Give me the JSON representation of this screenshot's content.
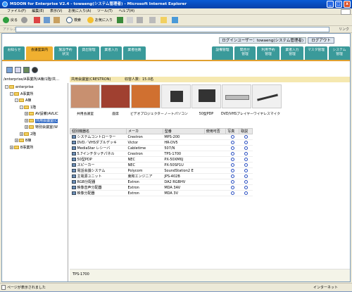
{
  "window": {
    "title": "MSOON for Enterprise V2.4 - towaeng(システム管理者) - Microsoft Internet Explorer",
    "controls": [
      "_",
      "□",
      "x"
    ]
  },
  "menu": [
    "ファイル(F)",
    "編集(E)",
    "表示(V)",
    "お気に入り(A)",
    "ツール(T)",
    "ヘルプ(H)"
  ],
  "toolbar": {
    "back": "戻る",
    "search": "検索",
    "favorites": "お気に入り"
  },
  "address": {
    "label": "アドレス(D)",
    "links": "リンク"
  },
  "login": {
    "user": "ログインユーザー：towaeng(システム管理者)",
    "logout": "ログアウト"
  },
  "tabs_left": [
    "お知らせ",
    "会議室案内",
    "施設予約\n状況",
    "貸出管理",
    "業者入力",
    "業者往路"
  ],
  "tabs_right": [
    "設備管理",
    "間合せ\n管理",
    "利用予約\n管理",
    "業者入力\n管理",
    "マスタ管理",
    "システム\n管理"
  ],
  "path": "/enterprise/A事業所/A棟/1階/共…",
  "room": {
    "name": "共用会議室(CRESTRON)",
    "capacity": "収容人数：15.0名"
  },
  "tree": [
    {
      "label": "enterprise",
      "indent": 0,
      "sign": "-"
    },
    {
      "label": "A事業所",
      "indent": 1,
      "sign": "-"
    },
    {
      "label": "A棟",
      "indent": 2,
      "sign": "-"
    },
    {
      "label": "1階",
      "indent": 3,
      "sign": "-"
    },
    {
      "label": "AV設備(AVLIC",
      "indent": 4,
      "sign": "+"
    },
    {
      "label": "共用会議室(C",
      "indent": 4,
      "sign": "+",
      "selected": true
    },
    {
      "label": "特別会議室(W",
      "indent": 4,
      "sign": "+"
    },
    {
      "label": "2階",
      "indent": 3,
      "sign": "+"
    },
    {
      "label": "B棟",
      "indent": 2,
      "sign": "+"
    },
    {
      "label": "B事業所",
      "indent": 1,
      "sign": "+"
    }
  ],
  "gallery": [
    {
      "caption": "共用会議室",
      "kind": "room"
    },
    {
      "caption": "座席",
      "kind": "seats"
    },
    {
      "caption": "ビデオプロジェクター",
      "kind": "projector"
    },
    {
      "caption": "ノートパソコン",
      "kind": "laptop"
    },
    {
      "caption": "50型PDP",
      "kind": "tv"
    },
    {
      "caption": "DVD/VHSプレイヤー",
      "kind": "dvd"
    },
    {
      "caption": "ワイヤレスマイク",
      "kind": "mic"
    }
  ],
  "table": {
    "headers": [
      "個別機器名",
      "メーカ",
      "型番",
      "使用可否",
      "写真",
      "取説"
    ],
    "rows": [
      [
        "システムコントローラー",
        "Crestron",
        "MPS-200",
        "",
        "○",
        "○"
      ],
      [
        "DVD／VHSダブルデッキ",
        "Victor",
        "HR-DV5",
        "",
        "○",
        "○"
      ],
      [
        "MediaStar レシーバ",
        "Cabletime",
        "507/N",
        "",
        "○",
        "○"
      ],
      [
        "5.7インチタッチパネル",
        "Crestron",
        "TPS-1700",
        "",
        "○",
        "○"
      ],
      [
        "50型PDP",
        "NEC",
        "PX-50XM6J",
        "",
        "○",
        "○"
      ],
      [
        "スピーカー",
        "NEC",
        "PX-50SP1U",
        "",
        "○",
        "○"
      ],
      [
        "電話会議システム",
        "Polycom",
        "SoundStation2 E",
        "",
        "○",
        "○"
      ],
      [
        "主電源ユニット",
        "東和エンジニア",
        "JPS-402B",
        "",
        "○",
        "○"
      ],
      [
        "RGB分配器",
        "Extron",
        "DA2 RGBHV",
        "",
        "○",
        "○"
      ],
      [
        "映像音声分配器",
        "Extron",
        "MDA 3AV",
        "",
        "○",
        "○"
      ],
      [
        "映像分配器",
        "Extron",
        "MDA 3V",
        "",
        "○",
        "○"
      ]
    ]
  },
  "footer": "TPS-1700",
  "status": {
    "text": "ページが表示されました",
    "zone": "インターネット"
  }
}
